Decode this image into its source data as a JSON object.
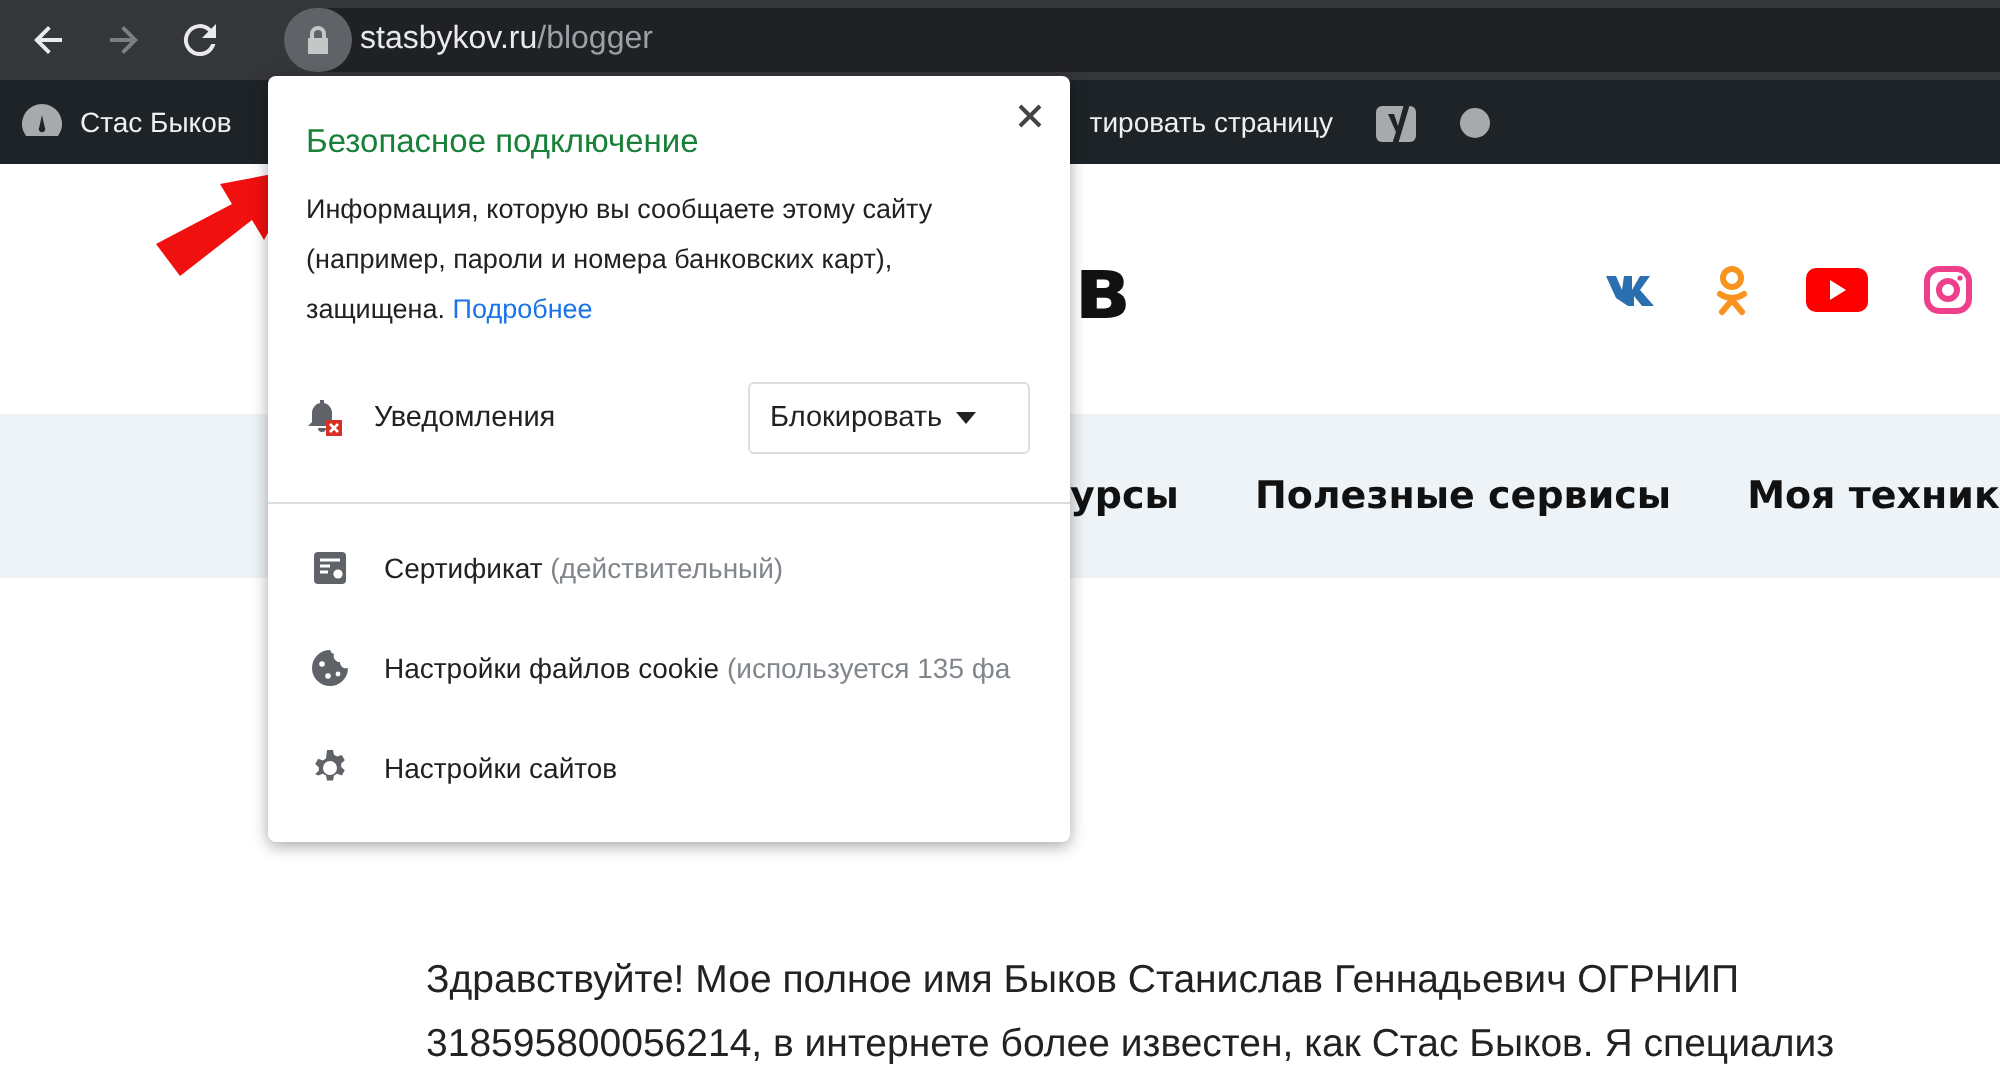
{
  "browser": {
    "nav_buttons": [
      {
        "kind": "back",
        "disabled": false
      },
      {
        "kind": "forward",
        "disabled": true
      },
      {
        "kind": "reload",
        "disabled": false
      }
    ],
    "url": {
      "host": "stasbykov.ru",
      "path": "/blogger"
    }
  },
  "admin_bar": {
    "site_name": "Стас Быков",
    "edit_link": "тировать страницу"
  },
  "site_header": {
    "logo_fragment": "в"
  },
  "nav_menu": [
    "урсы",
    "Полезные сервисы",
    "Моя техник"
  ],
  "content": {
    "paragraph_lines": [
      "Здравствуйте! Мое полное имя Быков Станислав Геннадьевич ОГРНИП",
      "318595800056214, в интернете более известен, как Стас Быков. Я специализ"
    ]
  },
  "popup": {
    "title": "Безопасное подключение",
    "description": "Информация, которую вы сообщаете этому сайту (например, пароли и номера банковских карт), защищена.",
    "link": "Подробнее",
    "permission": {
      "label": "Уведомления",
      "value": "Блокировать"
    },
    "rows": [
      {
        "kind": "certificate",
        "label": "Сертификат",
        "detail": "(действительный)"
      },
      {
        "kind": "cookies",
        "label": "Настройки файлов cookie",
        "detail": "(используется 135 фа"
      },
      {
        "kind": "site_settings",
        "label": "Настройки сайтов"
      }
    ]
  }
}
